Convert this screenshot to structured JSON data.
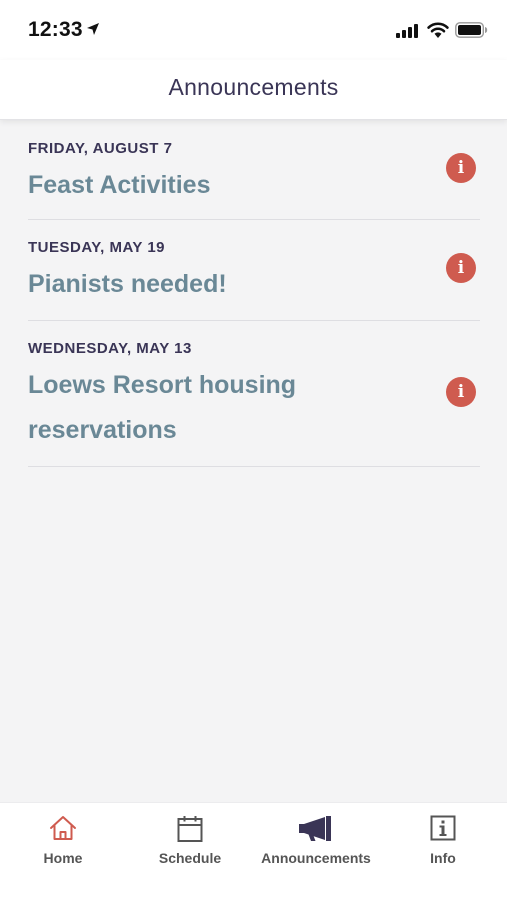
{
  "status_bar": {
    "time": "12:33"
  },
  "header": {
    "title": "Announcements"
  },
  "announcements": [
    {
      "date": "FRIDAY, AUGUST 7",
      "title": "Feast Activities"
    },
    {
      "date": "TUESDAY, MAY 19",
      "title": "Pianists needed!"
    },
    {
      "date": "WEDNESDAY, MAY 13",
      "title": "Loews Resort housing reservations"
    }
  ],
  "tabs": [
    {
      "label": "Home",
      "icon": "home-icon"
    },
    {
      "label": "Schedule",
      "icon": "calendar-icon"
    },
    {
      "label": "Announcements",
      "icon": "megaphone-icon"
    },
    {
      "label": "Info",
      "icon": "info-icon"
    }
  ],
  "colors": {
    "accent_red": "#cf5b4f",
    "title_slate": "#6a8896",
    "header_text": "#3a3556",
    "background": "#f4f4f5"
  }
}
